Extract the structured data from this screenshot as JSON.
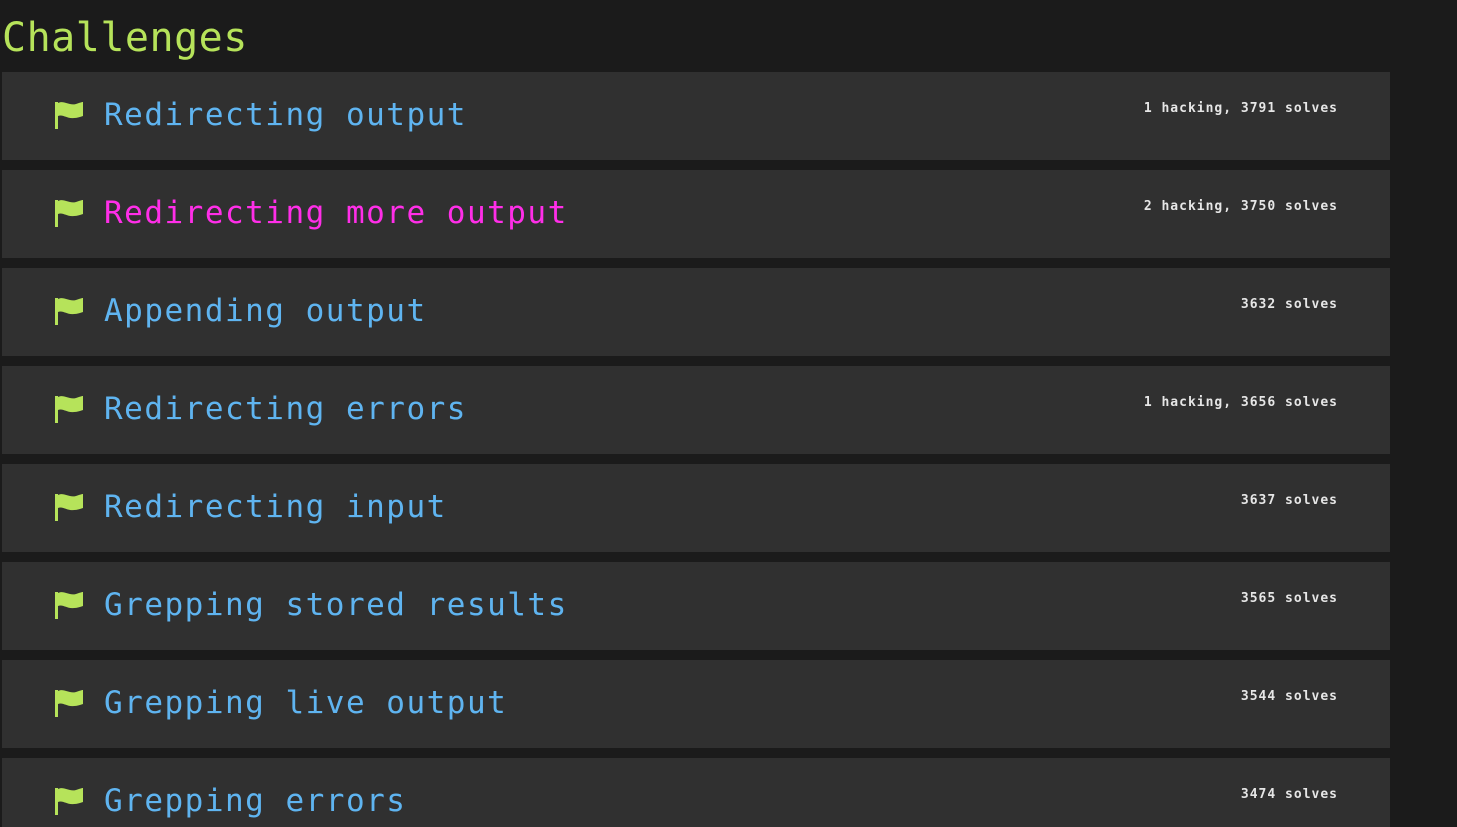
{
  "page": {
    "heading": "Challenges"
  },
  "colors": {
    "heading": "#b6e35a",
    "flag": "#b6e35a",
    "title_default": "#5fb4f0",
    "title_highlight": "#ff2ee8",
    "row_background": "#303030",
    "page_background": "#1b1b1b",
    "stats_text": "#e6e6e6"
  },
  "challenges": [
    {
      "icon": "flag-icon",
      "title": "Redirecting output",
      "stats": "1 hacking, 3791 solves",
      "highlighted": false
    },
    {
      "icon": "flag-icon",
      "title": "Redirecting more output",
      "stats": "2 hacking, 3750 solves",
      "highlighted": true
    },
    {
      "icon": "flag-icon",
      "title": "Appending output",
      "stats": "3632 solves",
      "highlighted": false
    },
    {
      "icon": "flag-icon",
      "title": "Redirecting errors",
      "stats": "1 hacking, 3656 solves",
      "highlighted": false
    },
    {
      "icon": "flag-icon",
      "title": "Redirecting input",
      "stats": "3637 solves",
      "highlighted": false
    },
    {
      "icon": "flag-icon",
      "title": "Grepping stored results",
      "stats": "3565 solves",
      "highlighted": false
    },
    {
      "icon": "flag-icon",
      "title": "Grepping live output",
      "stats": "3544 solves",
      "highlighted": false
    },
    {
      "icon": "flag-icon",
      "title": "Grepping errors",
      "stats": "3474 solves",
      "highlighted": false
    }
  ]
}
